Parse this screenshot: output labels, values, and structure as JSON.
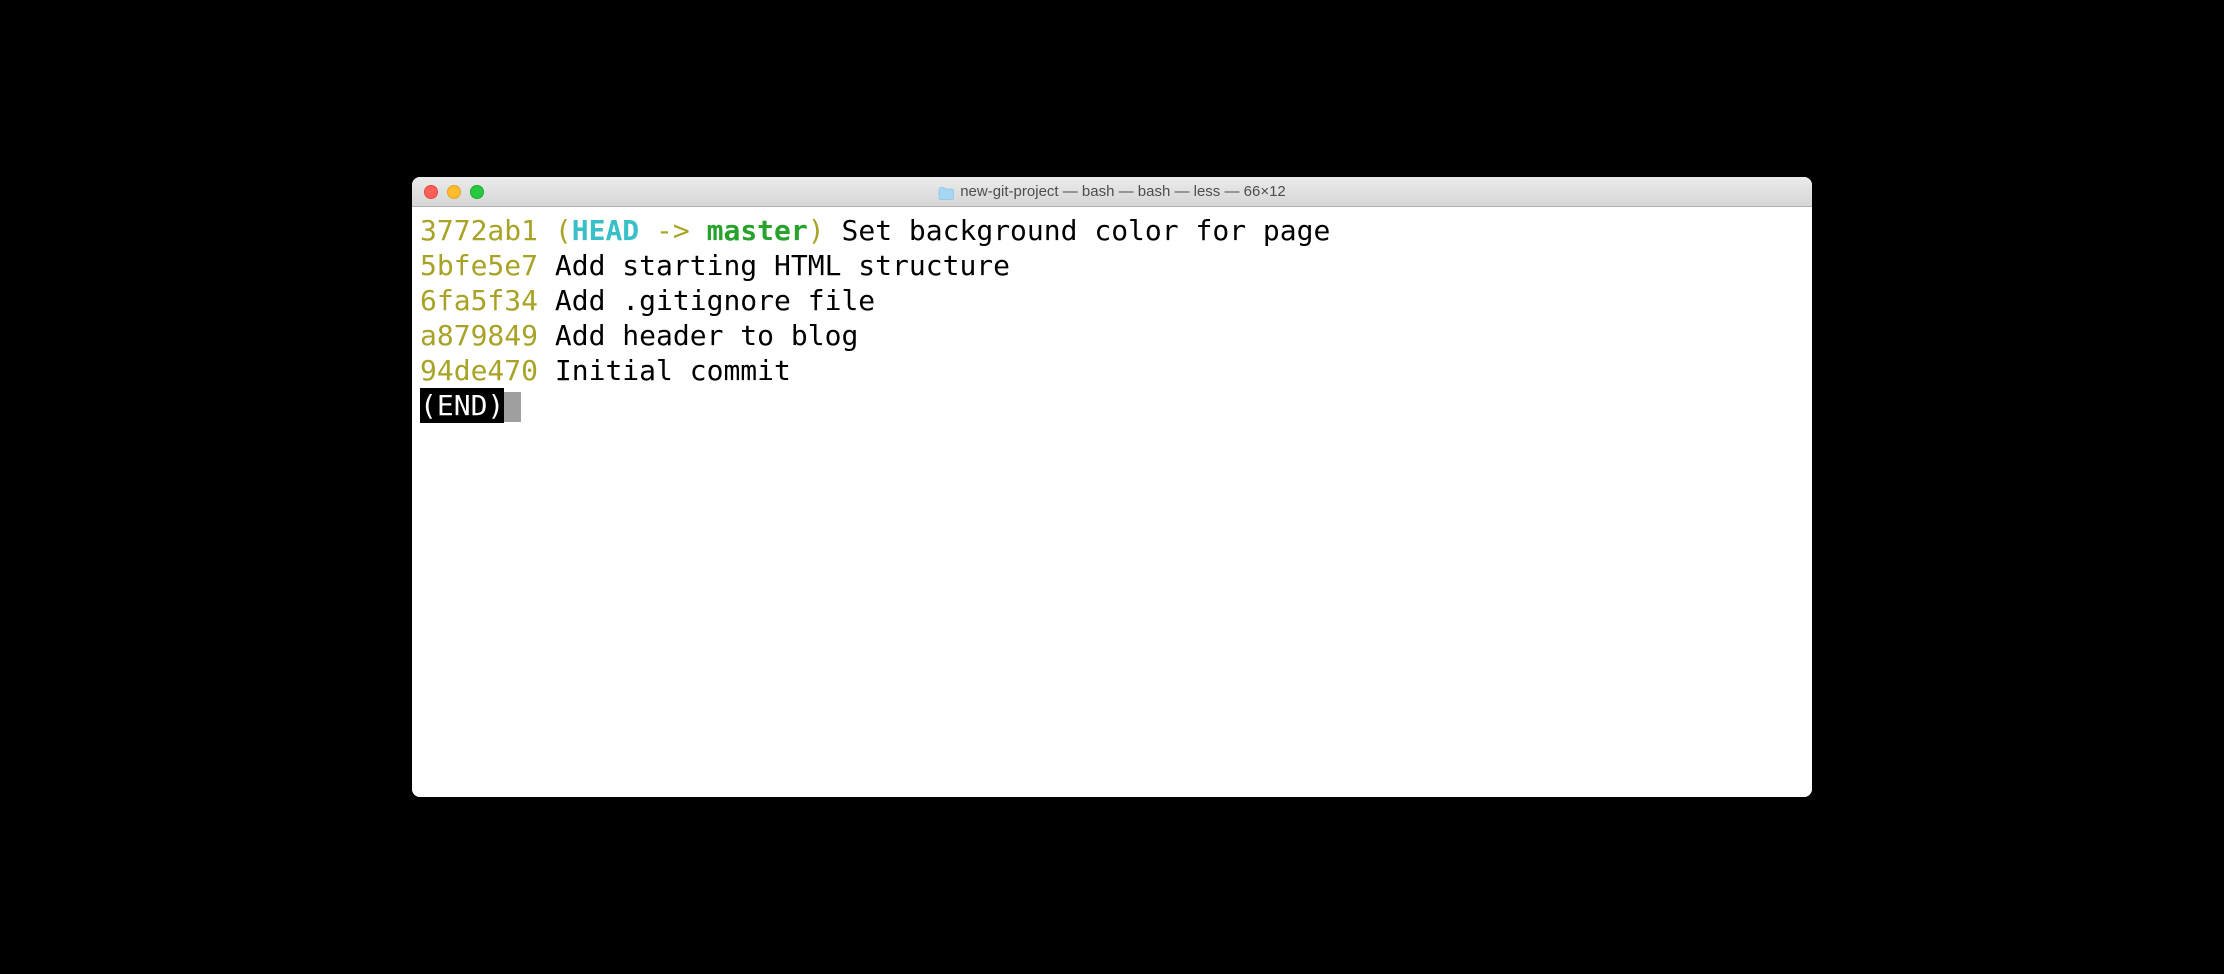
{
  "window": {
    "title": "new-git-project — bash — bash — less — 66×12"
  },
  "log": {
    "commits": [
      {
        "hash": "3772ab1",
        "ref_open": "(",
        "head": "HEAD",
        "arrow": " -> ",
        "branch": "master",
        "ref_close": ")",
        "message": "Set background color for page"
      },
      {
        "hash": "5bfe5e7",
        "message": "Add starting HTML structure"
      },
      {
        "hash": "6fa5f34",
        "message": "Add .gitignore file"
      },
      {
        "hash": "a879849",
        "message": "Add header to blog"
      },
      {
        "hash": "94de470",
        "message": "Initial commit"
      }
    ],
    "end_marker": "(END)"
  }
}
